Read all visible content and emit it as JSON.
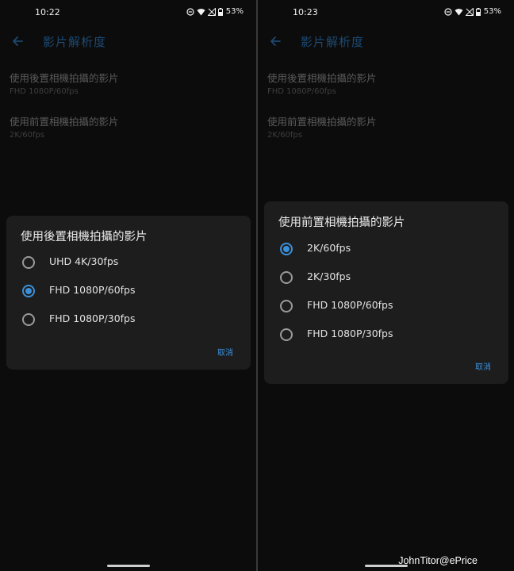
{
  "left": {
    "status": {
      "time": "10:22",
      "battery": "53%"
    },
    "appbar": {
      "title": "影片解析度"
    },
    "settings": [
      {
        "title": "使用後置相機拍攝的影片",
        "value": "FHD 1080P/60fps"
      },
      {
        "title": "使用前置相機拍攝的影片",
        "value": "2K/60fps"
      }
    ],
    "dialog": {
      "title": "使用後置相機拍攝的影片",
      "options": [
        "UHD 4K/30fps",
        "FHD 1080P/60fps",
        "FHD 1080P/30fps"
      ],
      "selected_index": 1,
      "cancel_label": "取消"
    }
  },
  "right": {
    "status": {
      "time": "10:23",
      "battery": "53%"
    },
    "appbar": {
      "title": "影片解析度"
    },
    "settings": [
      {
        "title": "使用後置相機拍攝的影片",
        "value": "FHD 1080P/60fps"
      },
      {
        "title": "使用前置相機拍攝的影片",
        "value": "2K/60fps"
      }
    ],
    "dialog": {
      "title": "使用前置相機拍攝的影片",
      "options": [
        "2K/60fps",
        "2K/30fps",
        "FHD 1080P/60fps",
        "FHD 1080P/30fps"
      ],
      "selected_index": 0,
      "cancel_label": "取消"
    }
  },
  "watermark": "JohnTitor@ePrice",
  "icons": [
    "dnd-icon",
    "wifi-icon",
    "cellular-no-signal-icon",
    "battery-icon",
    "back-arrow-icon"
  ],
  "colors": {
    "accent": "#3b8fd9",
    "dialog_bg": "#1d1d1d",
    "screen_bg": "#0c0c0c"
  }
}
